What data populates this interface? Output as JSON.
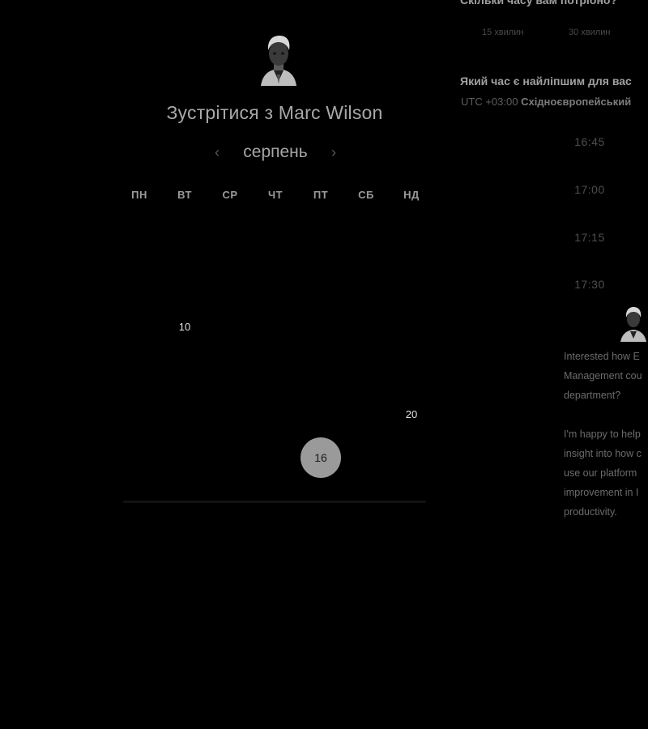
{
  "calendar": {
    "title": "Зустрітися з Marc Wilson",
    "month": "серпень",
    "prev_icon": "chevron-left-icon",
    "next_icon": "chevron-right-icon",
    "weekdays": [
      "ПН",
      "ВТ",
      "СР",
      "ЧТ",
      "ПТ",
      "СБ",
      "НД"
    ],
    "weeks": [
      [
        {
          "label": "",
          "state": "empty"
        },
        {
          "label": "",
          "state": "empty"
        },
        {
          "label": "",
          "state": "empty"
        },
        {
          "label": "",
          "state": "empty"
        },
        {
          "label": "",
          "state": "empty"
        },
        {
          "label": "",
          "state": "empty"
        },
        {
          "label": "",
          "state": "empty"
        }
      ],
      [
        {
          "label": "",
          "state": "empty"
        },
        {
          "label": "",
          "state": "empty"
        },
        {
          "label": "",
          "state": "empty"
        },
        {
          "label": "",
          "state": "empty"
        },
        {
          "label": "",
          "state": "empty"
        },
        {
          "label": "",
          "state": "empty"
        },
        {
          "label": "",
          "state": "empty"
        }
      ],
      [
        {
          "label": "",
          "state": "empty"
        },
        {
          "label": "10",
          "state": "active"
        },
        {
          "label": "",
          "state": "empty"
        },
        {
          "label": "",
          "state": "empty"
        },
        {
          "label": "",
          "state": "empty"
        },
        {
          "label": "",
          "state": "empty"
        },
        {
          "label": "",
          "state": "empty"
        }
      ],
      [
        {
          "label": "",
          "state": "empty"
        },
        {
          "label": "",
          "state": "empty"
        },
        {
          "label": "",
          "state": "empty"
        },
        {
          "label": "",
          "state": "empty"
        },
        {
          "label": "",
          "state": "empty"
        },
        {
          "label": "",
          "state": "empty"
        },
        {
          "label": "",
          "state": "empty"
        }
      ],
      [
        {
          "label": "",
          "state": "empty"
        },
        {
          "label": "",
          "state": "empty"
        },
        {
          "label": "",
          "state": "empty"
        },
        {
          "label": "",
          "state": "empty"
        },
        {
          "label": "",
          "state": "empty"
        },
        {
          "label": "",
          "state": "empty"
        },
        {
          "label": "20",
          "state": "active"
        }
      ],
      [
        {
          "label": "",
          "state": "empty"
        },
        {
          "label": "",
          "state": "empty"
        },
        {
          "label": "",
          "state": "empty"
        },
        {
          "label": "",
          "state": "empty"
        },
        {
          "label": "16",
          "state": "selected"
        },
        {
          "label": "",
          "state": "empty"
        },
        {
          "label": "",
          "state": "empty"
        }
      ]
    ]
  },
  "booking": {
    "duration_question": "Скільки часу вам потрібно?",
    "duration_options": [
      "15 хвилин",
      "30 хвилин"
    ],
    "time_question": "Який час є найліпшим для вас",
    "timezone_offset": "UTC +03:00",
    "timezone_name": "Східноєвропейський",
    "slots": [
      "16:45",
      "17:00",
      "17:15",
      "17:30"
    ],
    "chat_message": "Interested how E\nManagement cou\ndepartment?\n\nI'm happy to help\ninsight into how c\nuse our platform\nimprovement in I\nproductivity."
  },
  "colors": {
    "background": "#000000",
    "selected_day": "#9a9a9a",
    "text_muted": "#4e4e4e"
  }
}
